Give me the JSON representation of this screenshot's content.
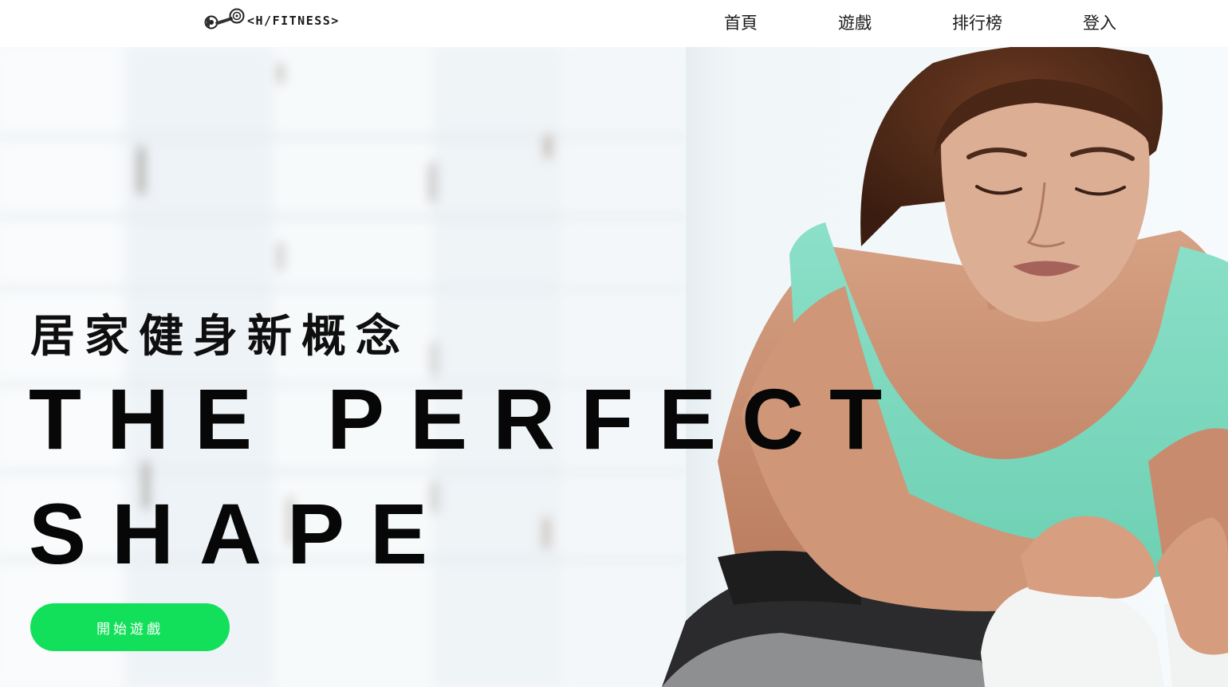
{
  "header": {
    "logo": {
      "text": "<H/FITNESS>",
      "icon": "dumbbell-icon"
    },
    "nav": [
      {
        "id": "home",
        "label": "首頁"
      },
      {
        "id": "game",
        "label": "遊戲"
      },
      {
        "id": "leaderboard",
        "label": "排行榜"
      },
      {
        "id": "login",
        "label": "登入"
      }
    ]
  },
  "hero": {
    "subtitle": "居家健身新概念",
    "headline_line1": "THE PERFECT",
    "headline_line2": "SHAPE",
    "cta_label": "開始遊戲"
  },
  "colors": {
    "accent": "#12e05a",
    "text": "#070707",
    "header_bg": "#ffffff",
    "tank_top": "#7fd6be"
  }
}
